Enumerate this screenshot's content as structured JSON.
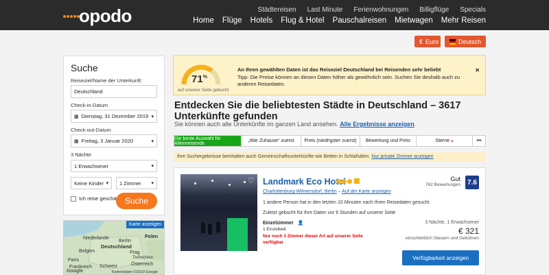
{
  "header": {
    "logo_text": "opodo",
    "top_nav": [
      "Städtereisen",
      "Last Minute",
      "Ferienwohnungen",
      "Billigflüge",
      "Specials"
    ],
    "main_nav": [
      "Home",
      "Flüge",
      "Hotels",
      "Flug & Hotel",
      "Pauschalreisen",
      "Mietwagen",
      "Mehr Reisen"
    ]
  },
  "currency": {
    "label": "Euro",
    "icon": "euro-icon"
  },
  "language": {
    "label": "Deutsch",
    "flag": "germany-flag-icon"
  },
  "search": {
    "title": "Suche",
    "destination_label": "Reiseziel/Name der Unterkunft:",
    "destination_value": "Deutschland",
    "checkin_label": "Check-in-Datum",
    "checkin_value": "Dienstag, 31 Dezember 2019",
    "checkout_label": "Check-out-Datum",
    "checkout_value": "Freitag, 3 Januar 2020",
    "nights": "3 Nächte",
    "adults": "1 Erwachsener",
    "children": "Keine Kinder",
    "rooms": "1 Zimmer",
    "business_label": "Ich reise geschäftlich",
    "button": "Suche"
  },
  "map": {
    "button": "Karte anzeigen",
    "labels": [
      "Niederlande",
      "Berlin",
      "Polen",
      "Deutschland",
      "Belgien",
      "Prag",
      "Tschechien",
      "Paris",
      "Österreich",
      "Frankreich",
      "Schweiz"
    ],
    "google": "Google",
    "copyright": "Kartendaten ©2019 Google"
  },
  "tip": {
    "percent": "71",
    "percent_sign": "%",
    "gauge_caption": "auf unserer Seite gebucht",
    "gauge_fraction": 0.71,
    "title": "An Ihren gewählten Daten ist das Reiseziel Deutschland bei Reisenden sehr beliebt",
    "text": "Tipp: Die Preise können an diesen Daten höher als gewöhnlich sein. Suchen Sie deshalb auch zu anderen Reisedaten."
  },
  "heading": {
    "title": "Entdecken Sie die beliebtesten Städte in Deutschland – 3617 Unterkünfte gefunden",
    "subtitle": "Sie können auch alle Unterkünfte im ganzen Land ansehen.",
    "link": "Alle Ergebnisse anzeigen",
    "link_suffix": "."
  },
  "sort_tabs": [
    "Die beste Auswahl für Alleinreisende",
    "„Wie Zuhause“ zuerst",
    "Preis (niedrigster zuerst)",
    "Bewertung und Preis",
    "Sterne",
    "•••"
  ],
  "strip": {
    "text": "Ihre Suchergebnisse beinhalten auch Gemeinschaftsunterkünfte wie Betten in Schlafsälen.",
    "link": "Nur private Zimmer anzeigen"
  },
  "hotel": {
    "name": "Landmark Eco Hotel",
    "stars": 3,
    "district": "Charlottenburg-Wilmersdorf, Berlin",
    "map_link": "Auf der Karte anzeigen",
    "booked": "1 andere Person hat in den letzten 10 Minuten nach Ihren Reisedaten gesucht",
    "last_booked": "Zuletzt gebucht für Ihre Daten vor 6 Stunden auf unserer Seite",
    "room": "Einzelzimmer",
    "bed": "1 Einzelbett",
    "warning": "Nur noch 3 Zimmer dieser Art auf unserer Seite verfügbar",
    "rating_word": "Gut",
    "reviews": "762 Bewertungen",
    "score": "7.6",
    "stay": "3 Nächte, 1 Erwachsener",
    "price": "€ 321",
    "price_note": "einschließlich Steuern und Gebühren",
    "button": "Verfügbarkeit anzeigen"
  },
  "colors": {
    "header_bg": "#2b2b2b",
    "accent_orange": "#f5781e",
    "link_blue": "#1a5faa",
    "primary_blue": "#1a6fc0",
    "sort_active": "#17a617",
    "score_bg": "#1c3d8c"
  }
}
